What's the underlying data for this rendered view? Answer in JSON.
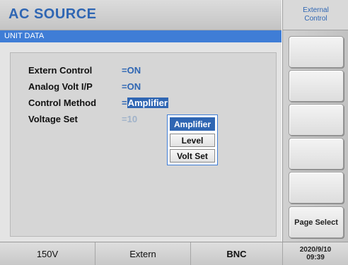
{
  "header": {
    "title": "AC SOURCE"
  },
  "softkeys": {
    "top_label": "External\nControl",
    "keys": [
      "",
      "",
      "",
      "",
      "",
      "Page Select"
    ]
  },
  "panel": {
    "title": "UNIT DATA",
    "rows": [
      {
        "label": "Extern Control",
        "value": "=ON"
      },
      {
        "label": "Analog Volt I/P",
        "value": "=ON"
      },
      {
        "label": "Control Method",
        "prefix": "=",
        "value": "Amplifier"
      },
      {
        "label": "Voltage Set",
        "value": "=10"
      }
    ],
    "dropdown": {
      "options": [
        "Amplifier",
        "Level",
        "Volt Set"
      ],
      "selected": "Amplifier"
    }
  },
  "statusbar": {
    "voltage": "150V",
    "mode": "Extern",
    "connector": "BNC",
    "datetime": "2020/9/10\n09:39"
  }
}
